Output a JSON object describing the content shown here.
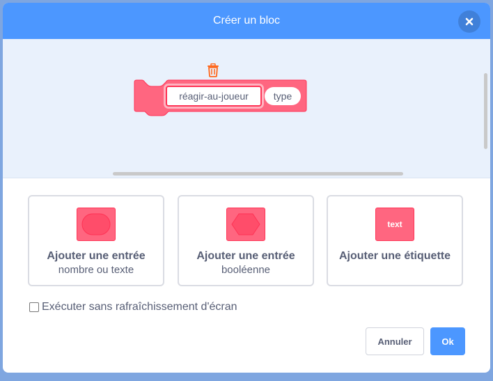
{
  "header": {
    "title": "Créer un bloc"
  },
  "block": {
    "name": "réagir-au-joueur",
    "param": "type"
  },
  "options": [
    {
      "title": "Ajouter une entrée",
      "subtitle": "nombre ou texte"
    },
    {
      "title": "Ajouter une entrée",
      "subtitle": "booléenne"
    },
    {
      "title": "Ajouter une étiquette",
      "subtitle": "",
      "icon_text": "text"
    }
  ],
  "run_without_refresh": {
    "label": "Exécuter sans rafraîchissement d'écran",
    "checked": false
  },
  "buttons": {
    "cancel": "Annuler",
    "ok": "Ok"
  },
  "colors": {
    "header": "#4c97ff",
    "block": "#ff6680",
    "block_border": "#ff3355",
    "workspace": "#e9f1fc"
  }
}
